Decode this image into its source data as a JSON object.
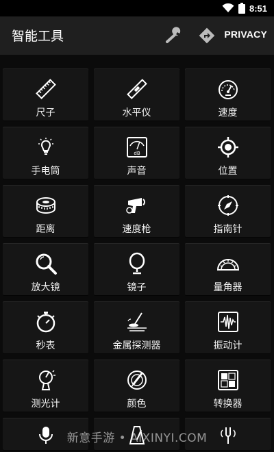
{
  "status": {
    "time": "8:51",
    "wifi_icon": "wifi-icon",
    "battery_icon": "battery-icon"
  },
  "appbar": {
    "title": "智能工具",
    "wrench_icon": "wrench-icon",
    "navigate_icon": "navigate-icon",
    "privacy_label": "PRIVACY"
  },
  "tools": [
    {
      "label": "尺子",
      "icon": "ruler-icon"
    },
    {
      "label": "水平仪",
      "icon": "level-icon"
    },
    {
      "label": "速度",
      "icon": "speedometer-icon"
    },
    {
      "label": "手电筒",
      "icon": "flashlight-icon"
    },
    {
      "label": "声音",
      "icon": "sound-meter-icon"
    },
    {
      "label": "位置",
      "icon": "location-icon"
    },
    {
      "label": "距离",
      "icon": "tape-measure-icon"
    },
    {
      "label": "速度枪",
      "icon": "speed-gun-icon"
    },
    {
      "label": "指南针",
      "icon": "compass-icon"
    },
    {
      "label": "放大镜",
      "icon": "magnifier-icon"
    },
    {
      "label": "镜子",
      "icon": "mirror-icon"
    },
    {
      "label": "量角器",
      "icon": "protractor-icon"
    },
    {
      "label": "秒表",
      "icon": "stopwatch-icon"
    },
    {
      "label": "金属探测器",
      "icon": "metal-detector-icon"
    },
    {
      "label": "振动计",
      "icon": "vibration-meter-icon"
    },
    {
      "label": "测光计",
      "icon": "light-meter-icon"
    },
    {
      "label": "颜色",
      "icon": "color-picker-icon"
    },
    {
      "label": "转换器",
      "icon": "converter-icon"
    }
  ],
  "partial_row": [
    {
      "icon": "microphone-icon"
    },
    {
      "icon": "metronome-icon"
    },
    {
      "icon": "tuning-fork-icon"
    }
  ],
  "watermark": "新意手游 • AIXINYI.COM"
}
